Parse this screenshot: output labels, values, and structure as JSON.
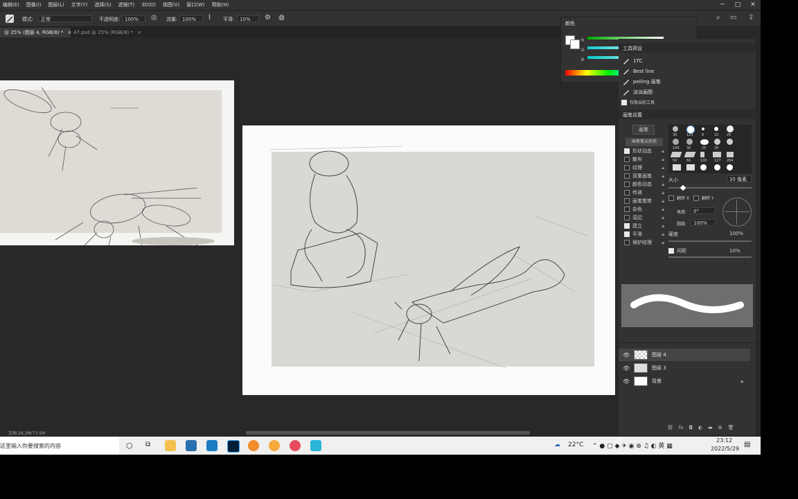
{
  "menu": [
    "编辑(E)",
    "图像(I)",
    "图层(L)",
    "文字(Y)",
    "选择(S)",
    "滤镜(T)",
    "3D(D)",
    "视图(V)",
    "窗口(W)",
    "帮助(H)"
  ],
  "window_controls": {
    "minimize": "─",
    "maximize": "□",
    "close": "✕"
  },
  "options": {
    "mode_label": "模式:",
    "mode_value": "正常",
    "opacity_label": "不透明度:",
    "opacity_value": "100%",
    "flow_label": "流量:",
    "flow_value": "100%",
    "smooth_label": "平滑:",
    "smooth_value": "10%"
  },
  "tabs": [
    {
      "label": "@ 25% (图层 4, RGB/8) *",
      "close": "×"
    },
    {
      "label": "47.psd @ 25% (RGB/8) *",
      "close": "×"
    }
  ],
  "color_panel": {
    "title": "颜色",
    "channels": [
      "R",
      "G",
      "B"
    ]
  },
  "tool_presets": {
    "title": "工具预设",
    "items": [
      "1TC",
      "Best line",
      "peiling 画笔",
      "淡淡画图"
    ],
    "current_tool_only": "仅限当前工具"
  },
  "brush_settings": {
    "title": "画笔设置",
    "presets_button": "画笔",
    "tip_shape": "画笔笔尖形状",
    "options": [
      {
        "label": "形状动态",
        "checked": true
      },
      {
        "label": "散布",
        "checked": false
      },
      {
        "label": "纹理",
        "checked": false
      },
      {
        "label": "双重画笔",
        "checked": false
      },
      {
        "label": "颜色动态",
        "checked": false
      },
      {
        "label": "传递",
        "checked": false
      },
      {
        "label": "画笔笔势",
        "checked": false
      },
      {
        "label": "杂色",
        "checked": false
      },
      {
        "label": "湿边",
        "checked": false
      },
      {
        "label": "建立",
        "checked": true
      },
      {
        "label": "平滑",
        "checked": true
      },
      {
        "label": "保护纹理",
        "checked": false
      }
    ],
    "tip_sizes": [
      "30",
      "123",
      "8",
      "10",
      "25",
      "100",
      "30",
      "25",
      "35",
      "50",
      "60",
      "100",
      "127",
      "284"
    ],
    "size_label": "大小",
    "size_value": "35 像素",
    "flip_x": "翻转 X",
    "flip_y": "翻转 Y",
    "angle_label": "角度:",
    "angle_value": "0°",
    "roundness_label": "圆度:",
    "roundness_value": "100%",
    "hardness_label": "硬度",
    "hardness_value": "100%",
    "spacing_label": "间距",
    "spacing_value": "10%"
  },
  "layers": [
    {
      "name": "图层 4",
      "selected": true
    },
    {
      "name": "图层 3",
      "selected": false
    },
    {
      "name": "背景",
      "selected": false,
      "locked": true
    }
  ],
  "status": {
    "doc": "文档:26.2M/73.5M"
  },
  "taskbar": {
    "search_placeholder": "这里输入你要搜索的内容",
    "weather": "22°C",
    "time": "23:12",
    "date": "2022/5/29"
  },
  "icons": {
    "brush": "brush-icon",
    "search": "search-icon",
    "eye": "eye-icon",
    "lock": "lock-icon"
  }
}
